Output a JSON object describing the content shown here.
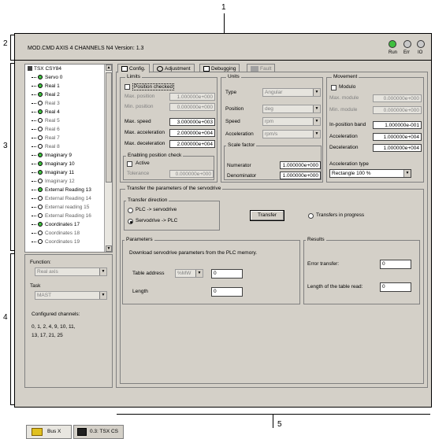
{
  "callouts": {
    "c1": "1",
    "c2": "2",
    "c3": "3",
    "c4": "4",
    "c5": "5"
  },
  "header": {
    "title": "MOD.CMD AXIS 4 CHANNELS N4   Version: 1.3",
    "leds": [
      {
        "label": "Run",
        "color": "#3fbf3f"
      },
      {
        "label": "Err",
        "color": "#c8c8c8"
      },
      {
        "label": "IO",
        "color": "#c8c8c8"
      }
    ]
  },
  "tree": {
    "root": "TSX CSY84",
    "items": [
      {
        "label": "Servo 0",
        "state": "on"
      },
      {
        "label": "Real 1",
        "state": "on"
      },
      {
        "label": "Real 2",
        "state": "on"
      },
      {
        "label": "Real 3",
        "state": "off"
      },
      {
        "label": "Real 4",
        "state": "on"
      },
      {
        "label": "Real 5",
        "state": "off"
      },
      {
        "label": "Real 6",
        "state": "off"
      },
      {
        "label": "Real 7",
        "state": "off"
      },
      {
        "label": "Real 8",
        "state": "off"
      },
      {
        "label": "Imaginary 9",
        "state": "on"
      },
      {
        "label": "Imaginary 10",
        "state": "on"
      },
      {
        "label": "Imaginary 11",
        "state": "on"
      },
      {
        "label": "Imaginary 12",
        "state": "off"
      },
      {
        "label": "External Reading 13",
        "state": "on"
      },
      {
        "label": "External Reading 14",
        "state": "off"
      },
      {
        "label": "External reading 15",
        "state": "off"
      },
      {
        "label": "External Reading 16",
        "state": "off"
      },
      {
        "label": "Coordinates 17",
        "state": "on"
      },
      {
        "label": "Coordinates 18",
        "state": "off"
      },
      {
        "label": "Coordinates 19",
        "state": "off"
      }
    ]
  },
  "lower": {
    "function_label": "Function:",
    "function_value": "Real axis",
    "task_label": "Task",
    "task_value": "MAST",
    "configured_label": "Configured channels:",
    "configured_line1": "0, 1, 2, 4, 9, 10, 11,",
    "configured_line2": "13, 17, 21, 25"
  },
  "tabs": [
    {
      "label": "Config."
    },
    {
      "label": "Adjustment"
    },
    {
      "label": "Debugging"
    },
    {
      "label": "Fault"
    }
  ],
  "limits": {
    "title": "Limits",
    "position_checked": "Position checked",
    "max_position_label": "Max. position",
    "max_position": "1.000000e+000",
    "min_position_label": "Min. position",
    "min_position": "0.000000e+000",
    "max_speed_label": "Max. speed",
    "max_speed": "3.000000e+003",
    "max_accel_label": "Max. acceleration",
    "max_accel": "2.000000e+004",
    "max_decel_label": "Max. deceleration",
    "max_decel": "2.000000e+004",
    "enabling_title": "Enabling position check",
    "active_label": "Active",
    "tolerance_label": "Tolerance",
    "tolerance": "0.000000e+000"
  },
  "units": {
    "title": "Units",
    "type_label": "Type",
    "type_value": "Angular",
    "position_label": "Position",
    "position_value": "deg",
    "speed_label": "Speed",
    "speed_value": "rpm",
    "accel_label": "Acceleration",
    "accel_value": "rpm/s",
    "scale_title": "Scale factor",
    "numerator_label": "Numerator",
    "numerator": "1.000000e+000",
    "denominator_label": "Denominator",
    "denominator": "1.000000e+000"
  },
  "movement": {
    "title": "Movement",
    "modulo_label": "Modulo",
    "max_module_label": "Max. module",
    "max_module": "0.000000e+000",
    "min_module_label": "Min. module",
    "min_module": "0.000000e+000",
    "inpos_label": "In-position band",
    "inpos": "1.000000e-001",
    "accel_label": "Acceleration",
    "accel": "1.000000e+004",
    "decel_label": "Deceleration",
    "decel": "1.000000e+004",
    "accel_type_label": "Acceleration type",
    "accel_type_value": "Rectangle 100 %"
  },
  "transfer": {
    "title": "Transfer the parameters of the servodrive",
    "direction_title": "Transfer direction",
    "plc_to_servo": "PLC -> servodrive",
    "servo_to_plc": "Servodrive -> PLC",
    "transfer_button": "Transfer",
    "in_progress": "Transfers in progress"
  },
  "parameters": {
    "title": "Parameters",
    "desc": "Download servodrive parameters from the PLC memory.",
    "table_address_label": "Table address",
    "table_address_type": "%MW",
    "table_address_value": "0",
    "length_label": "Length",
    "length_value": "0"
  },
  "results": {
    "title": "Results",
    "error_label": "Error transfer:",
    "error_value": "0",
    "length_label": "Length of the table read:",
    "length_value": "0"
  },
  "bottom_tabs": [
    {
      "label": "Bus X"
    },
    {
      "label": "0.3: TSX CS"
    }
  ]
}
